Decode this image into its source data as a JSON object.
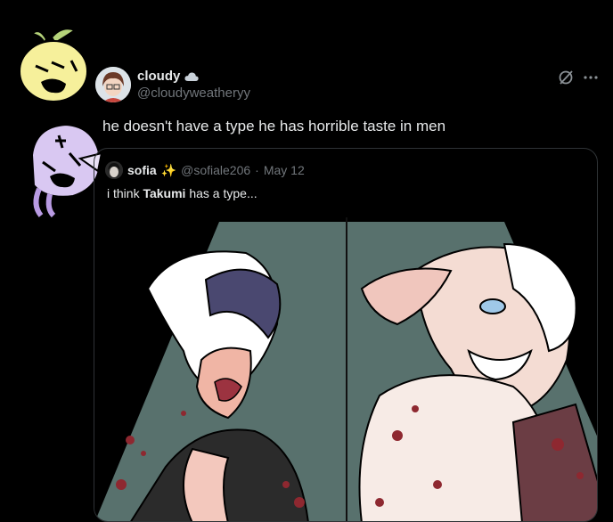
{
  "author": {
    "name": "cloudy",
    "handle": "@cloudyweatheryy",
    "badge_icon": "cloud-icon"
  },
  "tweet": {
    "text": "he doesn't have a type he has horrible taste in men"
  },
  "quote": {
    "name": "sofia",
    "badge": "✨",
    "handle": "@sofiale206",
    "separator": "·",
    "date": "May 12",
    "text_before": "i think ",
    "text_highlight": "Takumi",
    "text_after": " has a type..."
  },
  "icons": {
    "grok": "grok-icon",
    "more": "more-icon"
  },
  "colors": {
    "background": "#000000",
    "text": "#e7e9ea",
    "secondary": "#71767b",
    "border": "#2f3336"
  }
}
